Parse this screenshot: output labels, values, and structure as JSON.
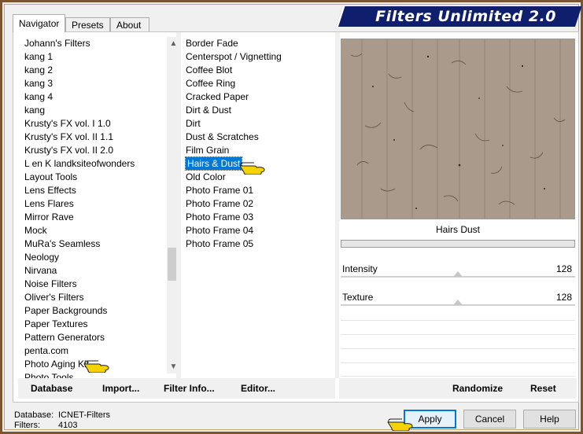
{
  "window": {
    "title": "Filters Unlimited 2.0"
  },
  "tabs": [
    {
      "label": "Navigator",
      "active": true
    },
    {
      "label": "Presets",
      "active": false
    },
    {
      "label": "About",
      "active": false
    }
  ],
  "categories": [
    "Johann's Filters",
    "kang 1",
    "kang 2",
    "kang 3",
    "kang 4",
    "kang",
    "Krusty's FX vol. I 1.0",
    "Krusty's FX vol. II 1.1",
    "Krusty's FX vol. II 2.0",
    "L en K landksiteofwonders",
    "Layout Tools",
    "Lens Effects",
    "Lens Flares",
    "Mirror Rave",
    "Mock",
    "MuRa's Seamless",
    "Neology",
    "Nirvana",
    "Noise Filters",
    "Oliver's Filters",
    "Paper Backgrounds",
    "Paper Textures",
    "Pattern Generators",
    "penta.com",
    "Photo Aging Kit",
    "Photo Tools"
  ],
  "filters": [
    "Border Fade",
    "Centerspot / Vignetting",
    "Coffee Blot",
    "Coffee Ring",
    "Cracked Paper",
    "Dirt & Dust",
    "Dirt",
    "Dust & Scratches",
    "Film Grain",
    "Hairs & Dust",
    "Old Color",
    "Photo Frame 01",
    "Photo Frame 02",
    "Photo Frame 03",
    "Photo Frame 04",
    "Photo Frame 05"
  ],
  "selected_filter_index": 9,
  "preview": {
    "filter_name": "Hairs  Dust"
  },
  "sliders": [
    {
      "label": "Intensity",
      "value": "128"
    },
    {
      "label": "Texture",
      "value": "128"
    }
  ],
  "left_buttons": {
    "database": "Database",
    "import": "Import...",
    "filter_info": "Filter Info...",
    "editor": "Editor..."
  },
  "right_buttons": {
    "randomize": "Randomize",
    "reset": "Reset"
  },
  "status": {
    "database_label": "Database:",
    "database_value": "ICNET-Filters",
    "filters_label": "Filters:",
    "filters_value": "4103"
  },
  "footer_buttons": {
    "apply": "Apply",
    "cancel": "Cancel",
    "help": "Help"
  },
  "colors": {
    "banner": "#0f1f6e",
    "selection": "#0078d7",
    "frame": "#7a5530",
    "pointer": "#f4d300"
  }
}
